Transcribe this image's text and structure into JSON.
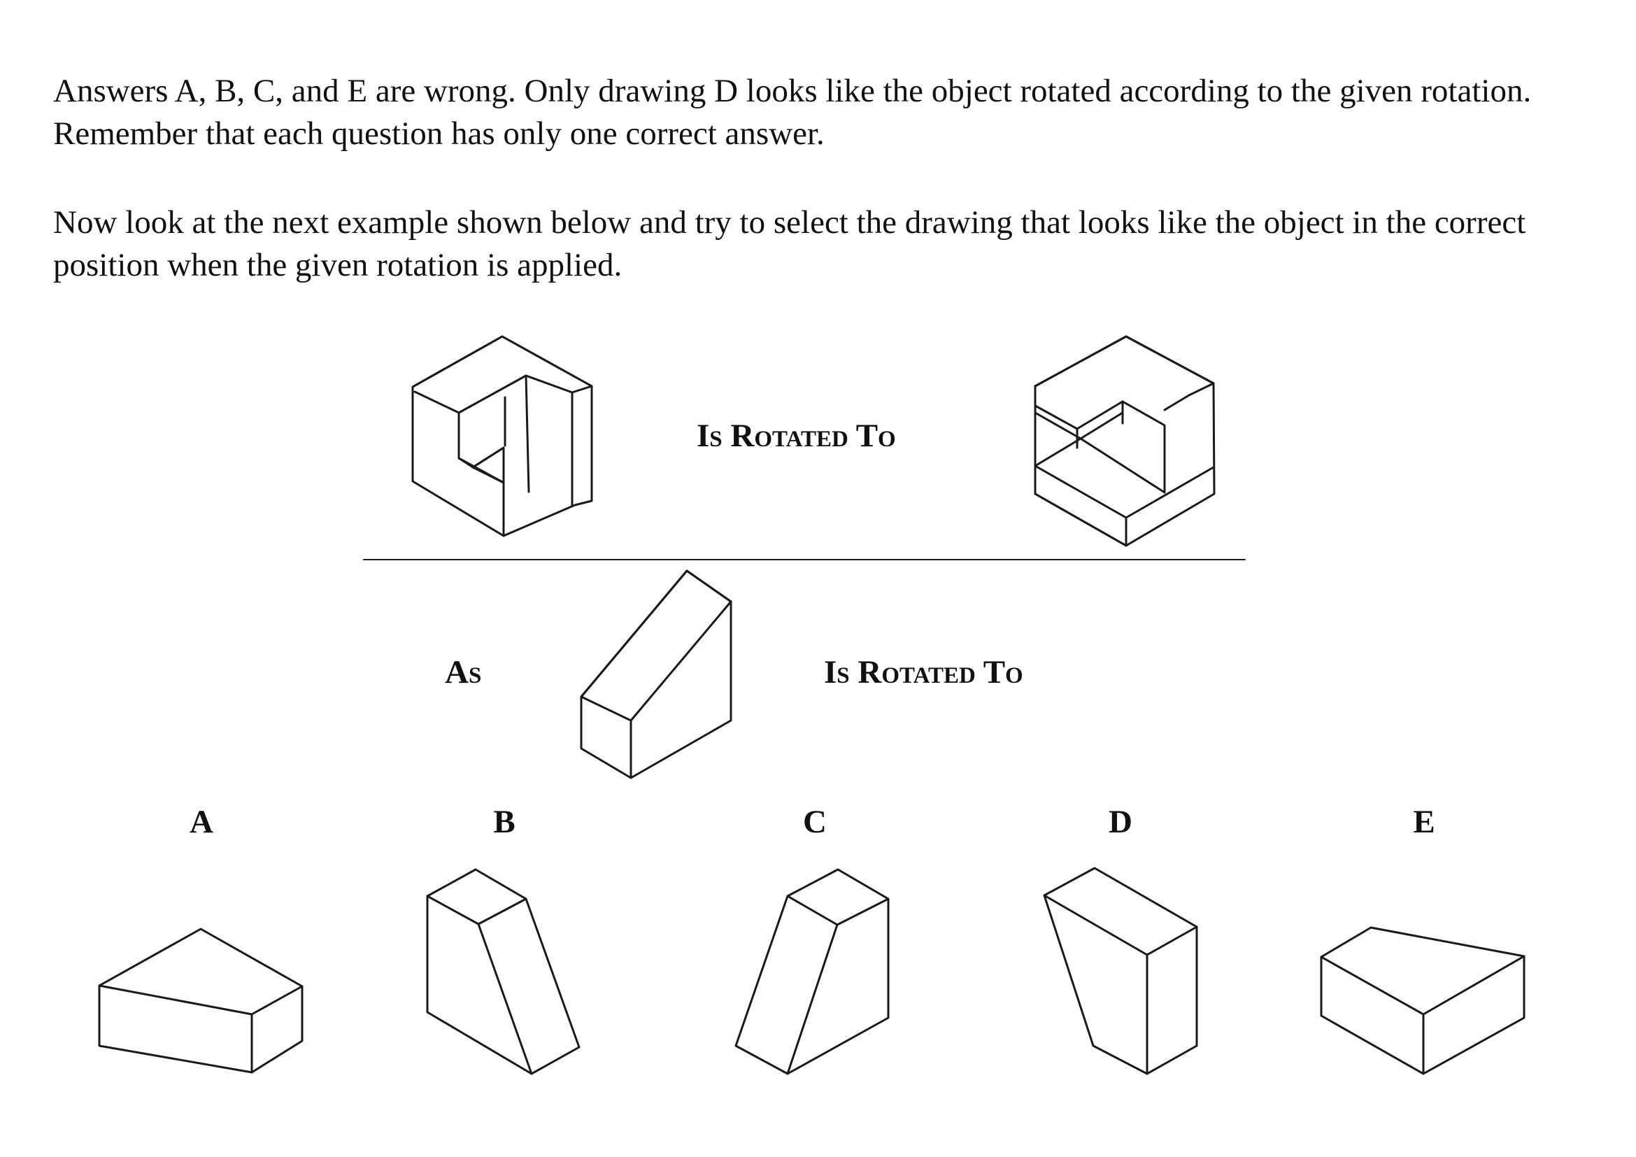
{
  "instructions": {
    "paragraph_1": "Answers A, B, C, and E are wrong. Only drawing D looks like the object rotated according to the given rotation. Remember that each question has only one correct answer.",
    "paragraph_2": "Now look at the next example shown below and try to select the drawing that looks like the object in the correct position when the given rotation is applied."
  },
  "example": {
    "rotation_label": "Is Rotated To"
  },
  "question": {
    "as_label": "As",
    "rotation_label": "Is Rotated To"
  },
  "options": [
    {
      "letter": "A",
      "icon": "wedge-option-a-drawing"
    },
    {
      "letter": "B",
      "icon": "wedge-option-b-drawing"
    },
    {
      "letter": "C",
      "icon": "wedge-option-c-drawing"
    },
    {
      "letter": "D",
      "icon": "wedge-option-d-drawing"
    },
    {
      "letter": "E",
      "icon": "wedge-option-e-drawing"
    }
  ],
  "colors": {
    "ink": "#1a1a1a",
    "background": "#ffffff"
  }
}
